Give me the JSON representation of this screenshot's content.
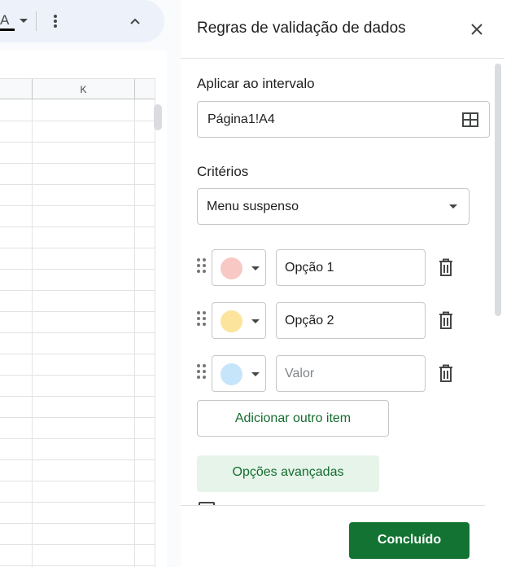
{
  "toolbar": {
    "text_color_glyph": "A",
    "icons": [
      "text-color-icon",
      "chevron-down-icon",
      "more-vert-icon",
      "chevron-up-icon"
    ]
  },
  "sheet": {
    "column_label": "K"
  },
  "panel": {
    "title": "Regras de validação de dados",
    "apply_range_label": "Aplicar ao intervalo",
    "range_value": "Página1!A4",
    "criteria_label": "Critérios",
    "criteria_value": "Menu suspenso",
    "options": [
      {
        "color": "#f8c9c4",
        "value": "Opção 1",
        "placeholder": ""
      },
      {
        "color": "#fce49d",
        "value": "Opção 2",
        "placeholder": ""
      },
      {
        "color": "#c6e4fa",
        "value": "",
        "placeholder": "Valor"
      }
    ],
    "add_item_label": "Adicionar outro item",
    "advanced_label": "Opções avançadas",
    "done_label": "Concluído"
  },
  "colors": {
    "accent_green": "#137333",
    "accent_green_text": "#146c2e",
    "advanced_bg": "#e6f4ea",
    "toolbar_bg": "#edf2fa"
  }
}
